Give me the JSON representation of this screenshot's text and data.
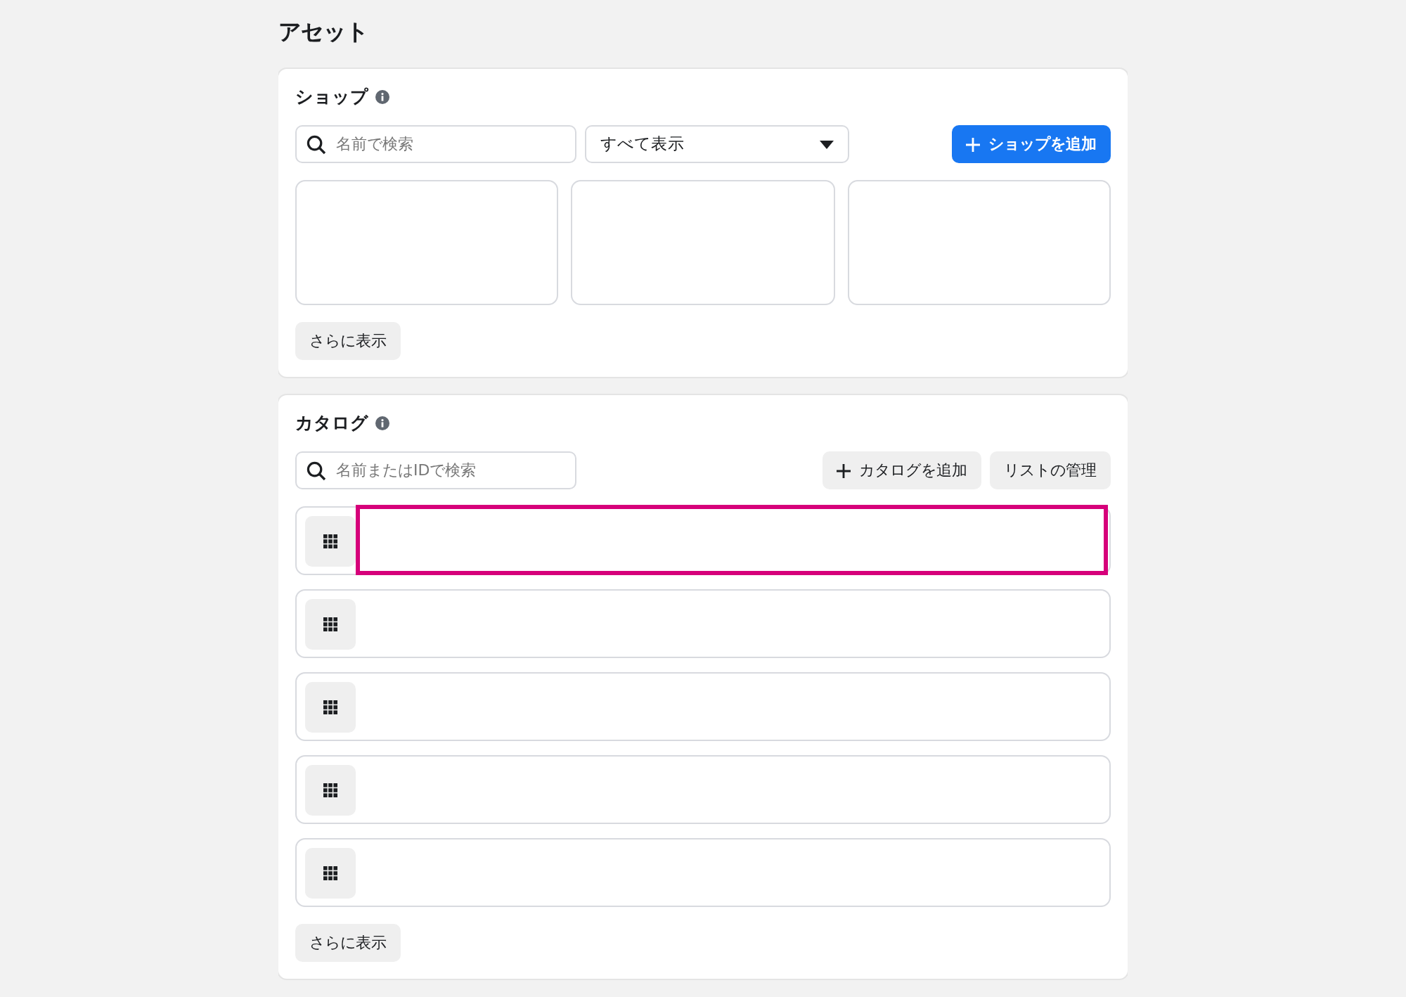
{
  "page": {
    "title": "アセット"
  },
  "shop": {
    "title": "ショップ",
    "search": {
      "placeholder": "名前で検索"
    },
    "filter": {
      "value": "すべて表示"
    },
    "add_button": "ショップを追加",
    "tiles": [
      {
        "kind": "empty"
      },
      {
        "kind": "empty"
      },
      {
        "kind": "empty"
      }
    ],
    "more_button": "さらに表示"
  },
  "catalog": {
    "title": "カタログ",
    "search": {
      "placeholder": "名前またはIDで検索"
    },
    "add_button": "カタログを追加",
    "manage_button": "リストの管理",
    "rows": [
      {
        "highlighted": true
      },
      {
        "highlighted": false
      },
      {
        "highlighted": false
      },
      {
        "highlighted": false
      },
      {
        "highlighted": false
      }
    ],
    "more_button": "さらに表示"
  }
}
